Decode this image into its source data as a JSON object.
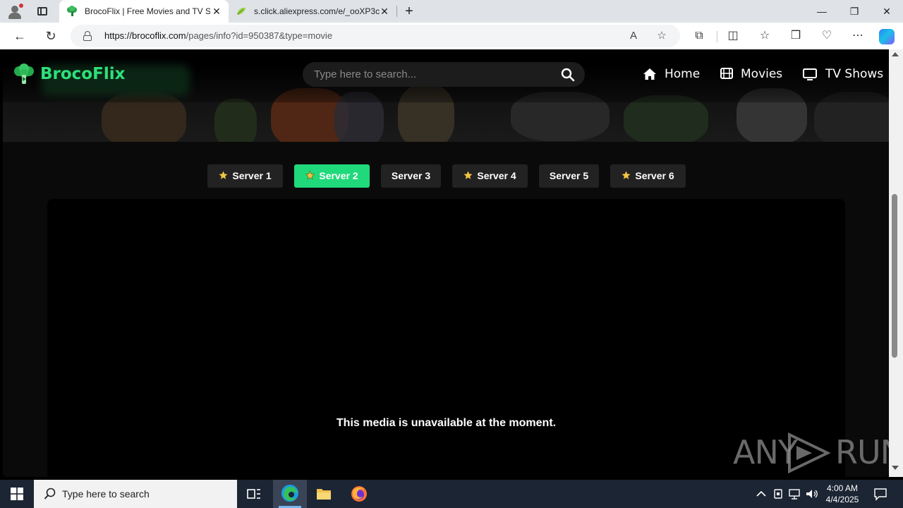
{
  "browser": {
    "tabs": [
      {
        "title": "BrocoFlix | Free Movies and TV Shows",
        "active": true
      },
      {
        "title": "s.click.aliexpress.com/e/_ooXP3c",
        "active": false
      }
    ],
    "url_host": "https://brocoflix.com",
    "url_path": "/pages/info?id=950387&type=movie",
    "new_tab_label": "+",
    "minimize_label": "—",
    "restore_label": "❐",
    "close_label": "✕"
  },
  "site": {
    "brand_name": "BrocoFlix",
    "brand_color": "#2ee07a",
    "search_placeholder": "Type here to search...",
    "nav": [
      {
        "label": "Home",
        "icon": "home-icon"
      },
      {
        "label": "Movies",
        "icon": "film-icon"
      },
      {
        "label": "TV Shows",
        "icon": "tv-icon"
      }
    ]
  },
  "servers": {
    "active_color": "#20d97a",
    "items": [
      {
        "label": "Server 1",
        "star": true,
        "active": false
      },
      {
        "label": "Server 2",
        "star": true,
        "active": true
      },
      {
        "label": "Server 3",
        "star": false,
        "active": false
      },
      {
        "label": "Server 4",
        "star": true,
        "active": false
      },
      {
        "label": "Server 5",
        "star": false,
        "active": false
      },
      {
        "label": "Server 6",
        "star": true,
        "active": false
      }
    ]
  },
  "player": {
    "message": "This media is unavailable at the moment."
  },
  "watermark": {
    "left": "ANY",
    "right": "RUN"
  },
  "taskbar": {
    "search_placeholder": "Type here to search",
    "time": "4:00 AM",
    "date": "4/4/2025"
  }
}
